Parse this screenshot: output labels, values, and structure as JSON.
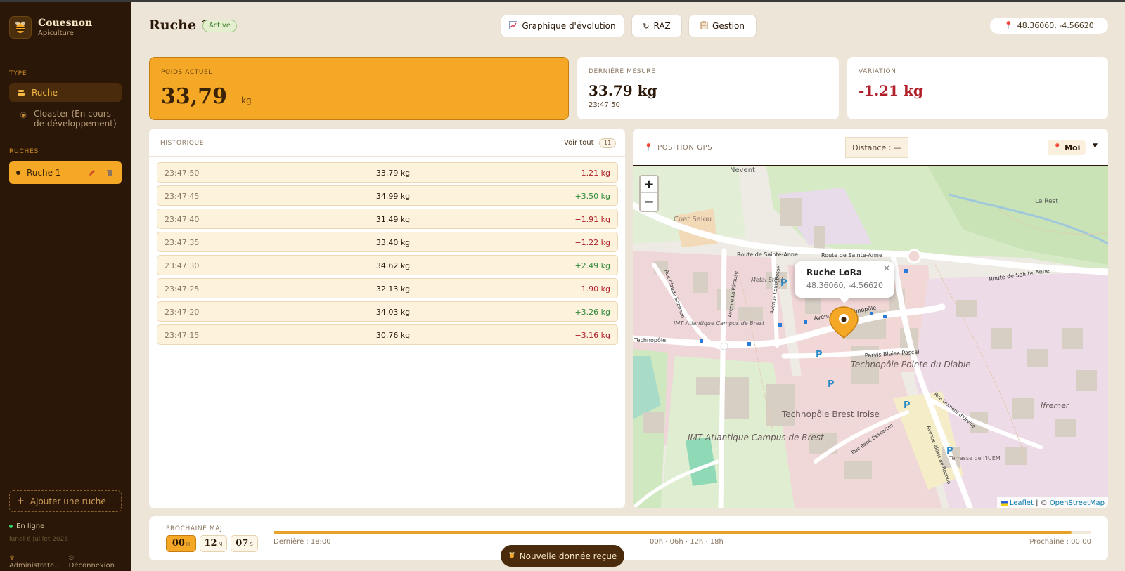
{
  "sidebar": {
    "brand_name": "Couesnon",
    "brand_sub": "Apiculture",
    "type_label": "TYPE",
    "types": [
      {
        "label": "Ruche",
        "icon": "hive-icon"
      },
      {
        "label": "Cloaster (En cours de développement)",
        "icon": "flower-icon"
      }
    ],
    "ruches_label": "RUCHES",
    "ruches": [
      {
        "label": "Ruche 1"
      }
    ],
    "add_label": "Ajouter une ruche",
    "status": "En ligne",
    "date": "lundi 6 juillet 2026",
    "admin": "Administrate...",
    "logout": "Déconnexion"
  },
  "header": {
    "title": "Ruche 1",
    "badge": "Active",
    "btn_graph": "Graphique d'évolution",
    "btn_raz": "RAZ",
    "btn_gestion": "Gestion",
    "coords": "48.36060, -4.56620"
  },
  "cards": {
    "poids_label": "POIDS ACTUEL",
    "poids_value": "33,79",
    "poids_unit": "kg",
    "mesure_label": "DERNIÈRE MESURE",
    "mesure_value": "33.79 kg",
    "mesure_time": "23:47:50",
    "variation_label": "VARIATION",
    "variation_value": "-1.21 kg"
  },
  "historique": {
    "label": "HISTORIQUE",
    "voir_tout": "Voir tout",
    "count": "11",
    "rows": [
      {
        "time": "23:47:50",
        "weight": "33.79 kg",
        "delta": "−1.21 kg",
        "sign": "neg"
      },
      {
        "time": "23:47:45",
        "weight": "34.99 kg",
        "delta": "+3.50 kg",
        "sign": "pos"
      },
      {
        "time": "23:47:40",
        "weight": "31.49 kg",
        "delta": "−1.91 kg",
        "sign": "neg"
      },
      {
        "time": "23:47:35",
        "weight": "33.40 kg",
        "delta": "−1.22 kg",
        "sign": "neg"
      },
      {
        "time": "23:47:30",
        "weight": "34.62 kg",
        "delta": "+2.49 kg",
        "sign": "pos"
      },
      {
        "time": "23:47:25",
        "weight": "32.13 kg",
        "delta": "−1.90 kg",
        "sign": "neg"
      },
      {
        "time": "23:47:20",
        "weight": "34.03 kg",
        "delta": "+3.26 kg",
        "sign": "pos"
      },
      {
        "time": "23:47:15",
        "weight": "30.76 kg",
        "delta": "−3.16 kg",
        "sign": "neg"
      }
    ]
  },
  "gps": {
    "label": "POSITION GPS",
    "distance": "Distance : —",
    "moi": "Moi",
    "popup_title": "Ruche LoRa",
    "popup_coords": "48.36060, -4.56620",
    "attr_leaflet": "Leaflet",
    "attr_sep": " | © ",
    "attr_osm": "OpenStreetMap",
    "map_labels": [
      "Nevent",
      "Le Rest",
      "Coat Salou",
      "Route de Sainte-Anne",
      "Route de Sainte-Anne",
      "Route de Sainte-Anne",
      "Metal Steel",
      "IMT Atlantique Campus de Brest",
      "Technopôle",
      "Avenue du Technopôle",
      "Parvis Blaise Pascal",
      "Technopôle Pointe du Diable",
      "Technopôle Brest Iroise",
      "IMT Atlantique Campus de Brest",
      "Ifremer",
      "Terrasse de l'IUEM",
      "Rue Claude Shannon",
      "Avenue La Pérouse",
      "Avenue Louis Rossel",
      "Rue René Descartes",
      "Avenue Alexis de Rochon",
      "Rue Dumont d'Urville"
    ]
  },
  "footer": {
    "label": "PROCHAINE MAJ",
    "hours": "00",
    "hours_unit": "H",
    "minutes": "12",
    "minutes_unit": "M",
    "seconds": "07",
    "seconds_unit": "S",
    "progress": 0.976,
    "last": "Dernière : 18:00",
    "ticks": "00h · 06h · 12h · 18h",
    "next": "Prochaine : 00:00"
  },
  "toast": "Nouvelle donnée reçue",
  "colors": {
    "accent": "#f4a826",
    "sidebar": "#2a1707",
    "negative": "#b0202a",
    "positive": "#2f8a3a"
  }
}
